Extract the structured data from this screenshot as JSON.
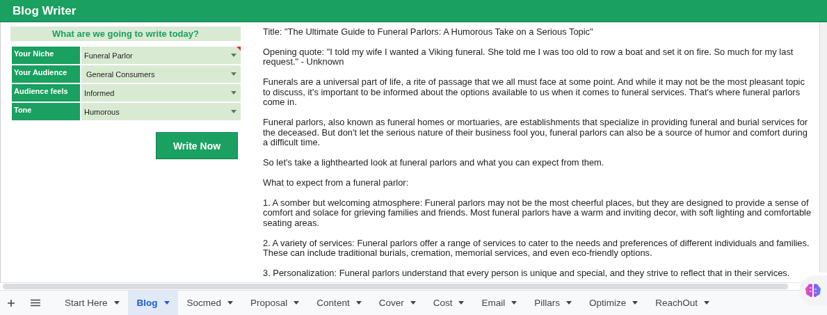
{
  "header": {
    "title": "Blog Writer"
  },
  "form": {
    "heading": "What are we going to write today?",
    "fields": [
      {
        "label": "Your Niche",
        "value": "Funeral Parlor",
        "flagged": true
      },
      {
        "label": "Your Audience",
        "value": " General Consumers",
        "flagged": false
      },
      {
        "label": "Audience feels",
        "value": "Informed",
        "flagged": false
      },
      {
        "label": "Tone",
        "value": "Humorous",
        "flagged": false
      }
    ],
    "button": "Write Now"
  },
  "output": {
    "paragraphs": [
      "Title: \"The Ultimate Guide to Funeral Parlors: A Humorous Take on a Serious Topic\"",
      "Opening quote: \"I told my wife I wanted a Viking funeral. She told me I was too old to row a boat and set it on fire. So much for my last request.\" - Unknown",
      "Funerals are a universal part of life, a rite of passage that we all must face at some point. And while it may not be the most pleasant topic to discuss, it's important to be informed about the options available to us when it comes to funeral services. That's where funeral parlors come in.",
      "Funeral parlors, also known as funeral homes or mortuaries, are establishments that specialize in providing funeral and burial services for the deceased. But don't let the serious nature of their business fool you, funeral parlors can also be a source of humor and comfort during a difficult time.",
      "So let's take a lighthearted look at funeral parlors and what you can expect from them.",
      "What to expect from a funeral parlor:",
      "1. A somber but welcoming atmosphere: Funeral parlors may not be the most cheerful places, but they are designed to provide a sense of comfort and solace for grieving families and friends. Most funeral parlors have a warm and inviting decor, with soft lighting and comfortable seating areas.",
      "2. A variety of services: Funeral parlors offer a range of services to cater to the needs and preferences of different individuals and families. These can include traditional burials, cremation, memorial services, and even eco-friendly options.",
      "3. Personalization: Funeral parlors understand that every person is unique and special, and they strive to reflect that in their services."
    ]
  },
  "sheet_tabs": [
    {
      "label": "Start Here",
      "selected": false
    },
    {
      "label": "Blog",
      "selected": true
    },
    {
      "label": "Socmed",
      "selected": false
    },
    {
      "label": "Proposal",
      "selected": false
    },
    {
      "label": "Content",
      "selected": false
    },
    {
      "label": "Cover",
      "selected": false
    },
    {
      "label": "Cost",
      "selected": false
    },
    {
      "label": "Email",
      "selected": false
    },
    {
      "label": "Pillars",
      "selected": false
    },
    {
      "label": "Optimize",
      "selected": false
    },
    {
      "label": "ReachOut",
      "selected": false
    }
  ]
}
